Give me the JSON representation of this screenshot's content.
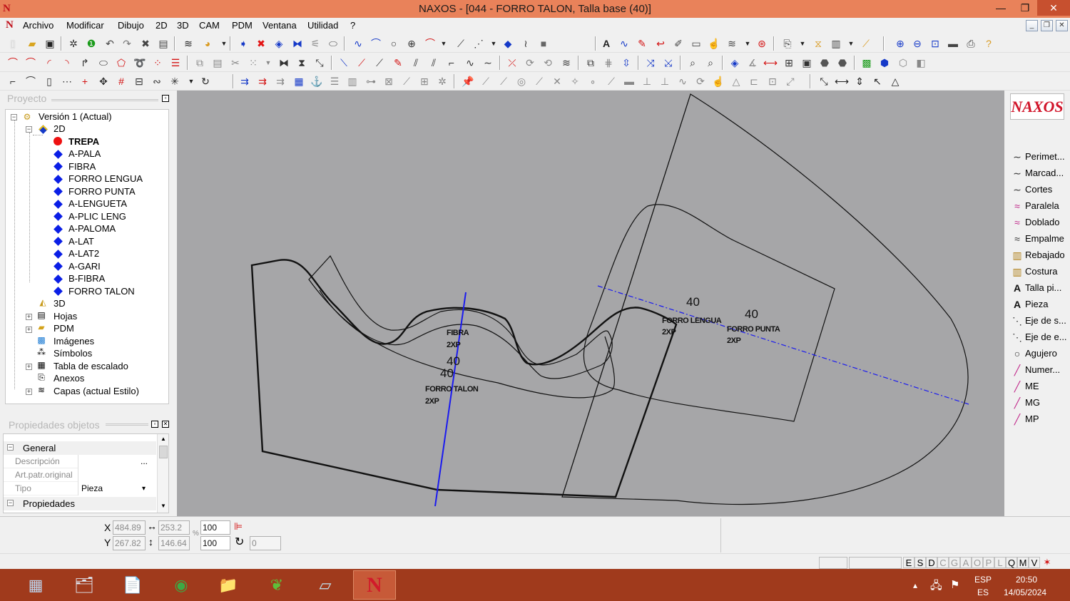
{
  "window": {
    "app_logo": "N",
    "title": "NAXOS - [044 - FORRO TALON, Talla base (40)]",
    "minimize": "—",
    "maximize": "❐",
    "close": "✕"
  },
  "menu": {
    "logo": "N",
    "items": [
      "Archivo",
      "Modificar",
      "Dibujo",
      "2D",
      "3D",
      "CAM",
      "PDM",
      "Ventana",
      "Utilidad",
      "?"
    ]
  },
  "project_panel": {
    "title": "Proyecto",
    "tree": {
      "root": "Versión 1 (Actual)",
      "node_2d": "2D",
      "pieces": [
        "TREPA",
        "A-PALA",
        "FIBRA",
        "FORRO LENGUA",
        "FORRO PUNTA",
        "A-LENGUETA",
        "A-PLIC LENG",
        "A-PALOMA",
        "A-LAT",
        "A-LAT2",
        "A-GARI",
        "B-FIBRA",
        "FORRO TALON"
      ],
      "active_piece": "TREPA",
      "node_3d": "3D",
      "others": [
        "Hojas",
        "PDM",
        "Imágenes",
        "Símbolos",
        "Tabla de escalado",
        "Anexos",
        "Capas (actual Estilo)"
      ]
    }
  },
  "properties_panel": {
    "title": "Propiedades objetos",
    "group_general": "General",
    "rows": [
      {
        "name": "Descripción",
        "value": "",
        "button": "..."
      },
      {
        "name": "Art.patr.original",
        "value": ""
      },
      {
        "name": "Tipo",
        "value": "Pieza",
        "dropdown": "▾"
      }
    ],
    "group_props": "Propiedades"
  },
  "canvas": {
    "background": "#a6a6a8",
    "labels": {
      "fibra_name": "FIBRA",
      "fibra_qty": "2XP",
      "fibra_size": "40",
      "talon_size": "40",
      "talon_name": "FORRO TALON",
      "talon_qty": "2XP",
      "lengua_size": "40",
      "lengua_name": "FORRO LENGUA",
      "lengua_qty": "2XP",
      "punta_size": "40",
      "punta_name": "FORRO PUNTA",
      "punta_qty": "2XP"
    }
  },
  "right_panel": {
    "logo": "NAXOS",
    "tools": [
      {
        "icon": "curve-icon",
        "glyph": "∼",
        "label": "Perimet..."
      },
      {
        "icon": "curve-icon",
        "glyph": "∼",
        "label": "Marcad..."
      },
      {
        "icon": "curve-icon",
        "glyph": "∼",
        "label": "Cortes"
      },
      {
        "icon": "parallel-icon",
        "glyph": "≈",
        "label": "Paralela"
      },
      {
        "icon": "fold-icon",
        "glyph": "≈",
        "label": "Doblado"
      },
      {
        "icon": "joint-icon",
        "glyph": "≈",
        "label": "Empalme"
      },
      {
        "icon": "skive-icon",
        "glyph": "▥",
        "label": "Rebajado"
      },
      {
        "icon": "seam-icon",
        "glyph": "▥",
        "label": "Costura"
      },
      {
        "icon": "text-icon",
        "glyph": "A",
        "label": "Talla pi..."
      },
      {
        "icon": "text-icon",
        "glyph": "A",
        "label": "Pieza"
      },
      {
        "icon": "axis-icon",
        "glyph": "⋱",
        "label": "Eje de s..."
      },
      {
        "icon": "axis-icon",
        "glyph": "⋱",
        "label": "Eje de e..."
      },
      {
        "icon": "hole-icon",
        "glyph": "○",
        "label": "Agujero"
      },
      {
        "icon": "number-icon",
        "glyph": "╱",
        "label": "Numer..."
      },
      {
        "icon": "mark-icon",
        "glyph": "╱",
        "label": "ME"
      },
      {
        "icon": "mark-icon",
        "glyph": "╱",
        "label": "MG"
      },
      {
        "icon": "mark-icon",
        "glyph": "╱",
        "label": "MP"
      }
    ]
  },
  "coords": {
    "x_label": "X",
    "y_label": "Y",
    "x": "484.89",
    "y": "267.82",
    "width": "253.2",
    "height": "146.64",
    "scale_x": "100",
    "scale_y": "100",
    "percent": "%",
    "rotation": "0"
  },
  "status": {
    "letters": [
      "E",
      "S",
      "D",
      "C",
      "G",
      "A",
      "O",
      "P",
      "L",
      "Q",
      "M",
      "V"
    ]
  },
  "taskbar": {
    "apps": [
      {
        "icon": "calculator-icon",
        "glyph": "▦"
      },
      {
        "icon": "explorer-icon",
        "glyph": "🗂"
      },
      {
        "icon": "document-icon",
        "glyph": "📄"
      },
      {
        "icon": "chrome-icon",
        "glyph": "◉"
      },
      {
        "icon": "folder-icon",
        "glyph": "📁"
      },
      {
        "icon": "leaf-icon",
        "glyph": "❦"
      },
      {
        "icon": "note-icon",
        "glyph": "▱"
      },
      {
        "icon": "naxos-icon",
        "glyph": "N"
      }
    ],
    "lang_top": "ESP",
    "lang_bottom": "ES",
    "time": "20:50",
    "date": "14/05/2024",
    "tray_up": "▴",
    "tray_network": "🖧",
    "tray_flag": "⚑"
  }
}
